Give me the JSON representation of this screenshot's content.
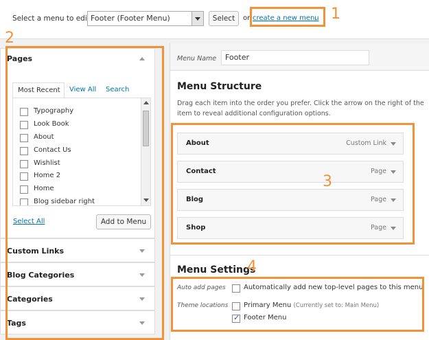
{
  "top_bar": {
    "select_label": "Select a menu to edit:",
    "selected_menu": "Footer (Footer Menu)",
    "select_button": "Select",
    "or_text": "or",
    "create_link": "create a new menu",
    "create_suffix": "."
  },
  "annotations": [
    "1",
    "2",
    "3",
    "4"
  ],
  "annotation_color": "#f0923a",
  "left_panel": {
    "pages_title": "Pages",
    "tabs": [
      "Most Recent",
      "View All",
      "Search"
    ],
    "pages": [
      {
        "label": "Typography",
        "checked": false
      },
      {
        "label": "Look Book",
        "checked": false
      },
      {
        "label": "About",
        "checked": false
      },
      {
        "label": "Contact Us",
        "checked": false
      },
      {
        "label": "Wishlist",
        "checked": false
      },
      {
        "label": "Home 2",
        "checked": false
      },
      {
        "label": "Home",
        "checked": false
      },
      {
        "label": "Blog sidebar right",
        "checked": false
      }
    ],
    "select_all": "Select All",
    "add_to_menu": "Add to Menu",
    "sections": [
      "Custom Links",
      "Blog Categories",
      "Categories",
      "Tags"
    ]
  },
  "right_panel": {
    "menu_name_label": "Menu Name",
    "menu_name_value": "Footer",
    "structure_title": "Menu Structure",
    "structure_desc": "Drag each item into the order you prefer. Click the arrow on the right of the item to reveal additional configuration options.",
    "items": [
      {
        "title": "About",
        "type": "Custom Link"
      },
      {
        "title": "Contact",
        "type": "Page"
      },
      {
        "title": "Blog",
        "type": "Page"
      },
      {
        "title": "Shop",
        "type": "Page"
      }
    ],
    "settings_title": "Menu Settings",
    "auto_add_label": "Auto add pages",
    "auto_add_text": "Automatically add new top-level pages to this menu",
    "theme_locations_label": "Theme locations",
    "primary_menu": "Primary Menu",
    "primary_note": "(Currently set to: Main Menu)",
    "footer_menu": "Footer Menu"
  }
}
